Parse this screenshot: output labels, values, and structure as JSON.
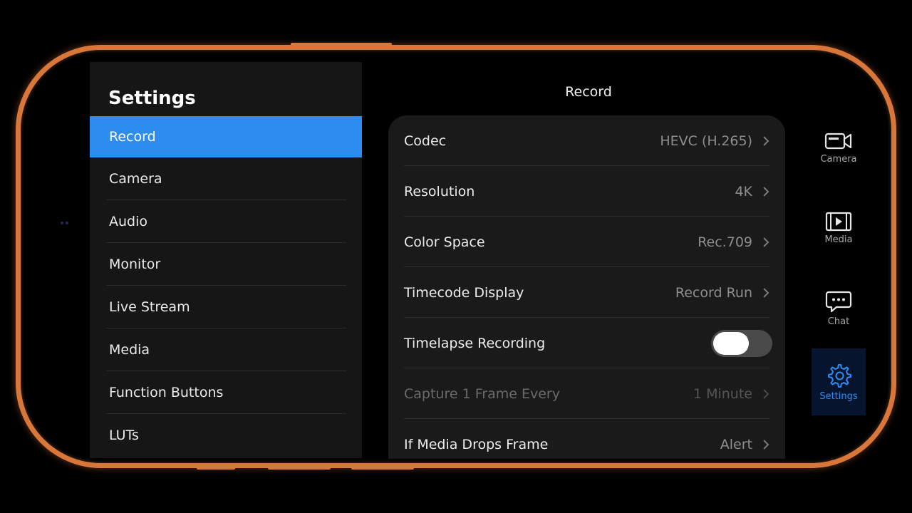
{
  "sidebar": {
    "title": "Settings",
    "items": [
      {
        "label": "Record",
        "active": true
      },
      {
        "label": "Camera"
      },
      {
        "label": "Audio"
      },
      {
        "label": "Monitor"
      },
      {
        "label": "Live Stream"
      },
      {
        "label": "Media"
      },
      {
        "label": "Function Buttons"
      },
      {
        "label": "LUTs"
      }
    ]
  },
  "main": {
    "title": "Record",
    "rows": [
      {
        "label": "Codec",
        "value": "HEVC (H.265)"
      },
      {
        "label": "Resolution",
        "value": "4K"
      },
      {
        "label": "Color Space",
        "value": "Rec.709"
      },
      {
        "label": "Timecode Display",
        "value": "Record Run"
      },
      {
        "label": "Timelapse Recording",
        "toggle": "off"
      },
      {
        "label": "Capture 1 Frame Every",
        "value": "1 Minute",
        "disabled": true
      },
      {
        "label": "If Media Drops Frame",
        "value": "Alert"
      }
    ]
  },
  "rightnav": {
    "items": [
      {
        "label": "Camera",
        "icon": "video-camera-icon"
      },
      {
        "label": "Media",
        "icon": "film-play-icon"
      },
      {
        "label": "Chat",
        "icon": "chat-bubble-icon"
      },
      {
        "label": "Settings",
        "icon": "gear-icon",
        "active": true
      }
    ]
  },
  "colors": {
    "accent": "#2d8cf0",
    "frame": "#d9773b",
    "background": "#000000",
    "panel": "#1a1a1a"
  }
}
